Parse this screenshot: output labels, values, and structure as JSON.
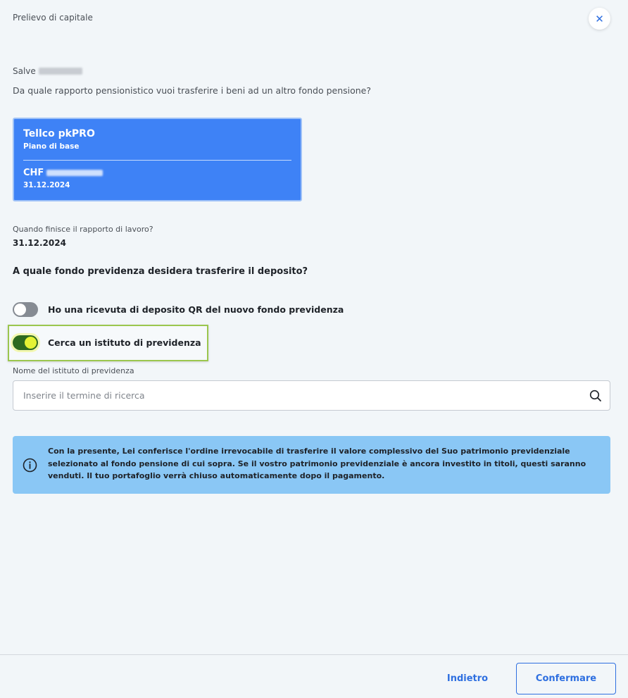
{
  "dialog": {
    "title": "Prelievo di capitale",
    "close_icon": "close-icon"
  },
  "greeting": {
    "salutation": "Salve"
  },
  "question_account": "Da quale rapporto pensionistico vuoi trasferire i beni ad un altro fondo pensione?",
  "account_card": {
    "name": "Tellco pkPRO",
    "plan": "Piano di base",
    "currency": "CHF",
    "date": "31.12.2024"
  },
  "employment_end": {
    "label": "Quando finisce il rapporto di lavoro?",
    "value": "31.12.2024"
  },
  "question_fund": "A quale fondo previdenza desidera trasferire il deposito?",
  "toggles": {
    "qr_receipt": {
      "label": "Ho una ricevuta di deposito QR del nuovo fondo previdenza",
      "state": "off"
    },
    "search_institution": {
      "label": "Cerca un istituto di previdenza",
      "state": "on"
    }
  },
  "institution_search": {
    "label": "Nome del istituto di previdenza",
    "placeholder": "Inserire il termine di ricerca",
    "value": ""
  },
  "info": {
    "icon": "info-icon",
    "text": "Con la presente, Lei conferisce l'ordine irrevocabile di trasferire il valore complessivo del Suo patrimonio previdenziale selezionato al fondo pensione di cui sopra. Se il vostro patrimonio previdenziale è ancora investito in titoli, questi saranno venduti. Il tuo portafoglio verrà chiuso automaticamente dopo il pagamento."
  },
  "footer": {
    "back_label": "Indietro",
    "confirm_label": "Confermare"
  },
  "colors": {
    "accent": "#2e6fe0",
    "card": "#3e82f6",
    "info_bg": "#8ac7f5",
    "toggle_on": "#2d6a1f"
  }
}
